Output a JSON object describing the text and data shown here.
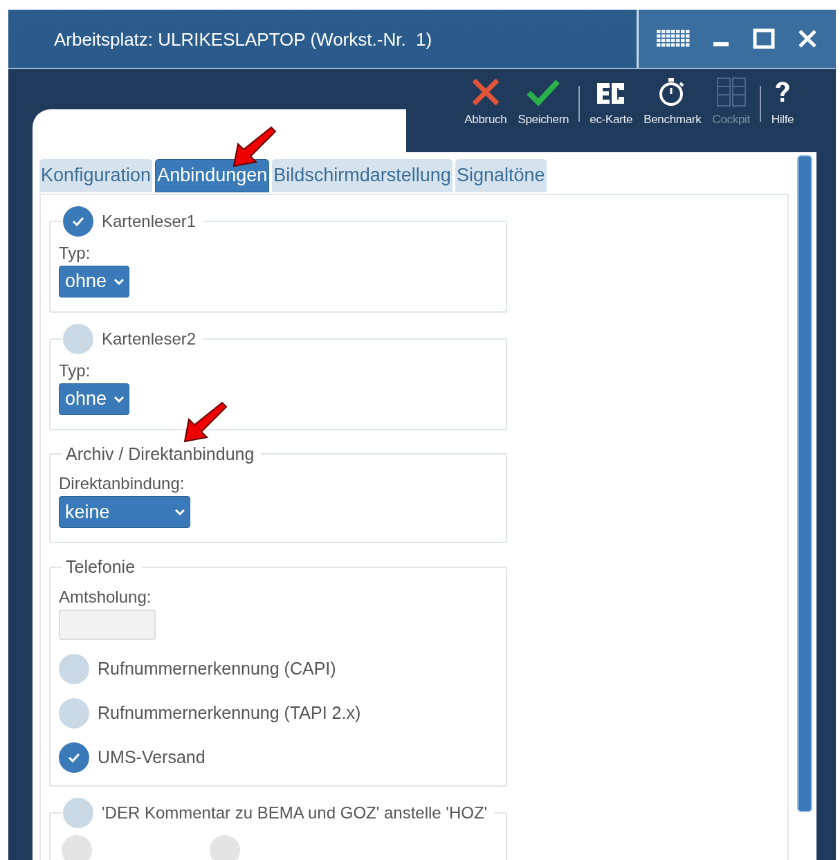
{
  "window": {
    "title": "Arbeitsplatz: ULRIKESLAPTOP (Workst.-Nr.  1)"
  },
  "toolbar": [
    {
      "kind": "cancel",
      "label": "Abbruch",
      "disabled": false
    },
    {
      "kind": "save",
      "label": "Speichern",
      "disabled": false
    },
    {
      "kind": "separator"
    },
    {
      "kind": "ec",
      "label": "ec-Karte",
      "disabled": false
    },
    {
      "kind": "stopwatch",
      "label": "Benchmark",
      "disabled": false
    },
    {
      "kind": "cockpit",
      "label": "Cockpit",
      "disabled": true
    },
    {
      "kind": "separator"
    },
    {
      "kind": "help",
      "label": "Hilfe",
      "disabled": false
    }
  ],
  "tabs": [
    {
      "label": "Konfiguration",
      "selected": false
    },
    {
      "label": "Anbindungen",
      "selected": true,
      "annotated": true
    },
    {
      "label": "Bildschirmdarstellung",
      "selected": false
    },
    {
      "label": "Signaltöne",
      "selected": false
    }
  ],
  "groups": [
    {
      "kind": "select",
      "title": "Kartenleser1",
      "enabled": true,
      "field_label": "Typ:",
      "value": "ohne",
      "wide": false
    },
    {
      "kind": "select",
      "title": "Kartenleser2",
      "enabled": false,
      "field_label": "Typ:",
      "value": "ohne",
      "wide": false
    },
    {
      "kind": "select",
      "title": "Archiv / Direktanbindung",
      "field_label": "Direktanbindung:",
      "value": "keine",
      "wide": true,
      "annotated": true
    },
    {
      "kind": "telefonie",
      "title": "Telefonie",
      "field_label": "Amtsholung:",
      "options": [
        {
          "label": "Rufnummernerkennung (CAPI)",
          "checked": false
        },
        {
          "label": "Rufnummernerkennung (TAPI 2.x)",
          "checked": false
        },
        {
          "label": "UMS-Versand",
          "checked": true
        }
      ]
    },
    {
      "kind": "partial",
      "title": "'DER Kommentar zu BEMA und GOZ' anstelle 'HOZ'",
      "enabled": false,
      "options": [
        {
          "disabled": true
        },
        {
          "disabled": true
        }
      ]
    }
  ]
}
